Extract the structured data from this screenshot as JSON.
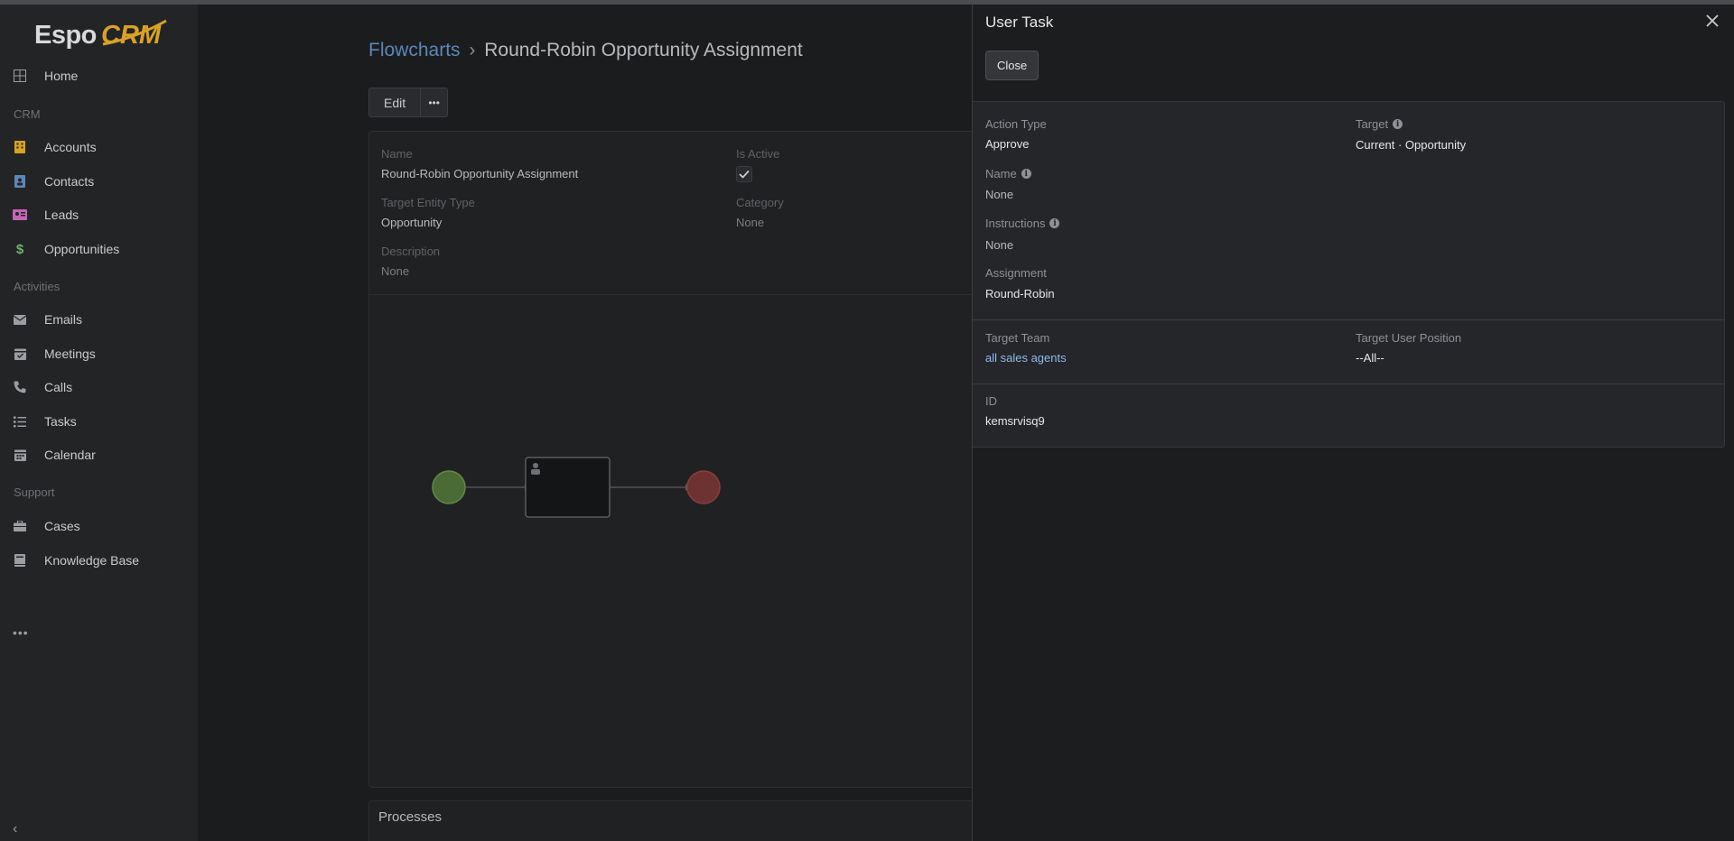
{
  "logo": {
    "text_espo": "Espo",
    "text_crm": "CRM"
  },
  "sidebar": {
    "home": "Home",
    "sections": {
      "crm": "CRM",
      "activities": "Activities",
      "support": "Support"
    },
    "crm_items": [
      "Accounts",
      "Contacts",
      "Leads",
      "Opportunities"
    ],
    "activity_items": [
      "Emails",
      "Meetings",
      "Calls",
      "Tasks",
      "Calendar"
    ],
    "support_items": [
      "Cases",
      "Knowledge Base"
    ],
    "more": "•••",
    "collapse": "‹"
  },
  "breadcrumb": {
    "parent": "Flowcharts",
    "separator": "›",
    "current": "Round-Robin Opportunity Assignment"
  },
  "record": {
    "edit_label": "Edit",
    "more_label": "•••",
    "fields": {
      "name_label": "Name",
      "name_value": "Round-Robin Opportunity Assignment",
      "is_active_label": "Is Active",
      "target_entity_label": "Target Entity Type",
      "target_entity_value": "Opportunity",
      "category_label": "Category",
      "category_value": "None",
      "description_label": "Description",
      "description_value": "None"
    },
    "processes_title": "Processes"
  },
  "sidepanel": {
    "title": "User Task",
    "close_label": "Close",
    "action_type_label": "Action Type",
    "action_type_value": "Approve",
    "target_label": "Target",
    "target_value": "Current · Opportunity",
    "name_label": "Name",
    "name_value": "None",
    "instructions_label": "Instructions",
    "instructions_value": "None",
    "assignment_label": "Assignment",
    "assignment_value": "Round-Robin",
    "target_team_label": "Target Team",
    "target_team_value": "all sales agents",
    "target_user_position_label": "Target User Position",
    "target_user_position_value": "--All--",
    "id_label": "ID",
    "id_value": "kemsrvisq9"
  },
  "colors": {
    "accounts_icon": "#d9a126",
    "contacts_icon": "#5b87b8",
    "leads_icon": "#c267b3",
    "opportunities_icon": "#6db36d",
    "link": "#8fb9e8"
  }
}
